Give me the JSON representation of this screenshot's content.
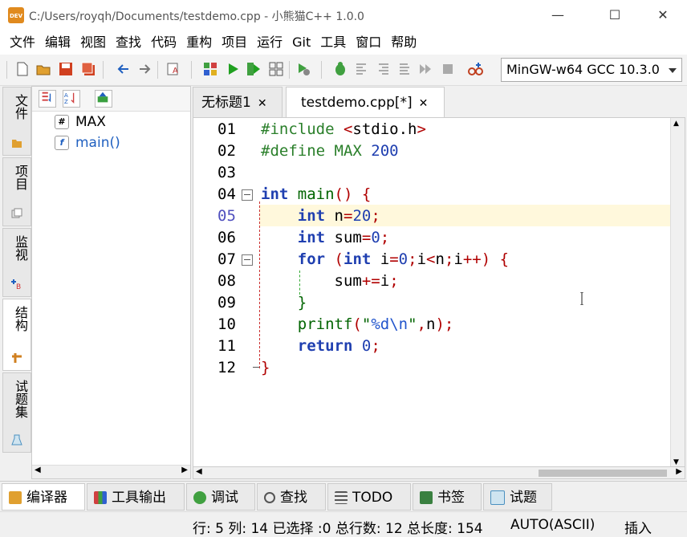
{
  "window": {
    "app_icon": "DEV",
    "title": "C:/Users/royqh/Documents/testdemo.cpp  - 小熊猫C++ 1.0.0",
    "minimize": "—",
    "maximize": "☐",
    "close": "✕"
  },
  "menu": [
    "文件",
    "编辑",
    "视图",
    "查找",
    "代码",
    "重构",
    "项目",
    "运行",
    "Git",
    "工具",
    "窗口",
    "帮助"
  ],
  "toolbar": {
    "compiler": "MinGW-w64 GCC 10.3.0"
  },
  "left_tabs": [
    {
      "label": "文件",
      "icon": "folder-icon"
    },
    {
      "label": "项目",
      "icon": "project-icon"
    },
    {
      "label": "监视",
      "icon": "watch-icon"
    },
    {
      "label": "结构",
      "icon": "structure-icon",
      "active": true
    },
    {
      "label": "试题集",
      "icon": "problem-set-icon"
    }
  ],
  "structure": {
    "items": [
      {
        "icon": "#",
        "label": "MAX"
      },
      {
        "icon": "f",
        "label": "main()"
      }
    ]
  },
  "editor_tabs": [
    {
      "label": "无标题1",
      "close": "✕"
    },
    {
      "label": "testdemo.cpp[*]",
      "close": "✕",
      "active": true
    }
  ],
  "editor": {
    "current_line": 5,
    "line_numbers": [
      "01",
      "02",
      "03",
      "04",
      "05",
      "06",
      "07",
      "08",
      "09",
      "10",
      "11",
      "12"
    ]
  },
  "bottom_tabs": [
    {
      "label": "编译器",
      "icon": "compiler-icon",
      "active": true
    },
    {
      "label": "工具输出",
      "icon": "chart-icon"
    },
    {
      "label": "调试",
      "icon": "bug-icon"
    },
    {
      "label": "查找",
      "icon": "search-icon"
    },
    {
      "label": "TODO",
      "icon": "todo-icon"
    },
    {
      "label": "书签",
      "icon": "bookmark-icon"
    },
    {
      "label": "试题",
      "icon": "flask-icon"
    }
  ],
  "status": {
    "position": "行: 5 列: 14 已选择 :0 总行数: 12 总长度: 154",
    "encoding": "AUTO(ASCII)",
    "mode": "插入"
  },
  "colors": {
    "keyword": "#1f3fb0",
    "preprocessor": "#2a7f2a",
    "operator": "#b00000",
    "current_line_bg": "#fff8dc"
  }
}
